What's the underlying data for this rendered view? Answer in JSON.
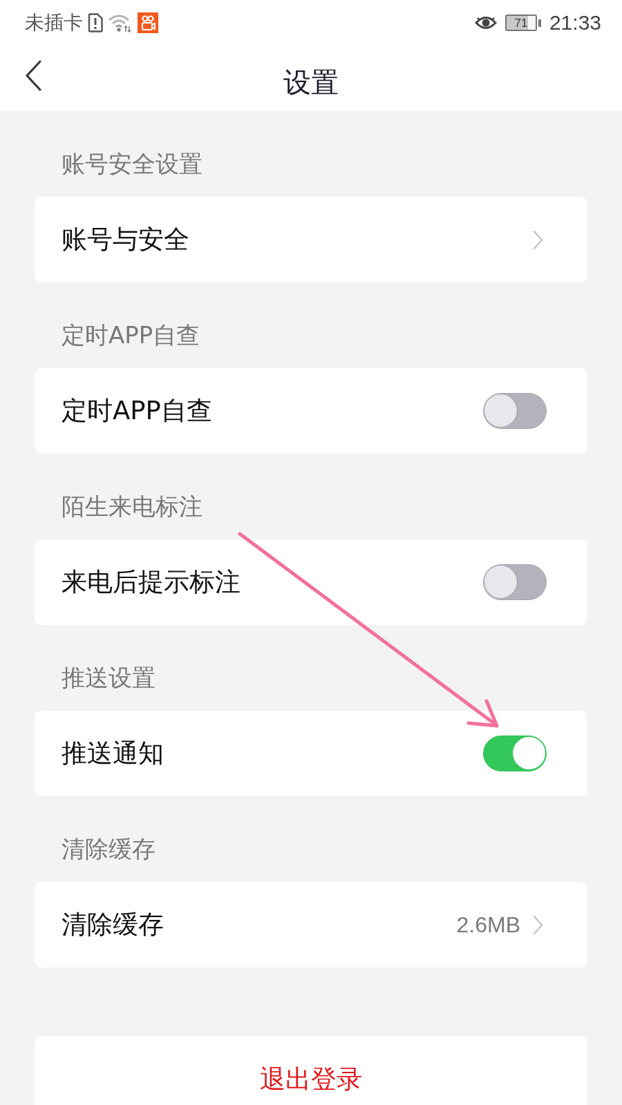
{
  "status_bar": {
    "carrier": "未插卡",
    "battery_text": "71",
    "time": "21:33"
  },
  "header": {
    "title": "设置"
  },
  "sections": [
    {
      "label": "账号安全设置",
      "row": {
        "kind": "link",
        "label": "账号与安全"
      }
    },
    {
      "label": "定时APP自查",
      "row": {
        "kind": "toggle",
        "label": "定时APP自查",
        "on": false
      }
    },
    {
      "label": "陌生来电标注",
      "row": {
        "kind": "toggle",
        "label": "来电后提示标注",
        "on": false
      }
    },
    {
      "label": "推送设置",
      "row": {
        "kind": "toggle",
        "label": "推送通知",
        "on": true
      }
    },
    {
      "label": "清除缓存",
      "row": {
        "kind": "link",
        "label": "清除缓存",
        "value": "2.6MB"
      }
    }
  ],
  "logout_button": {
    "label": "退出登录"
  },
  "annotations": [
    {
      "kind": "arrow"
    }
  ]
}
